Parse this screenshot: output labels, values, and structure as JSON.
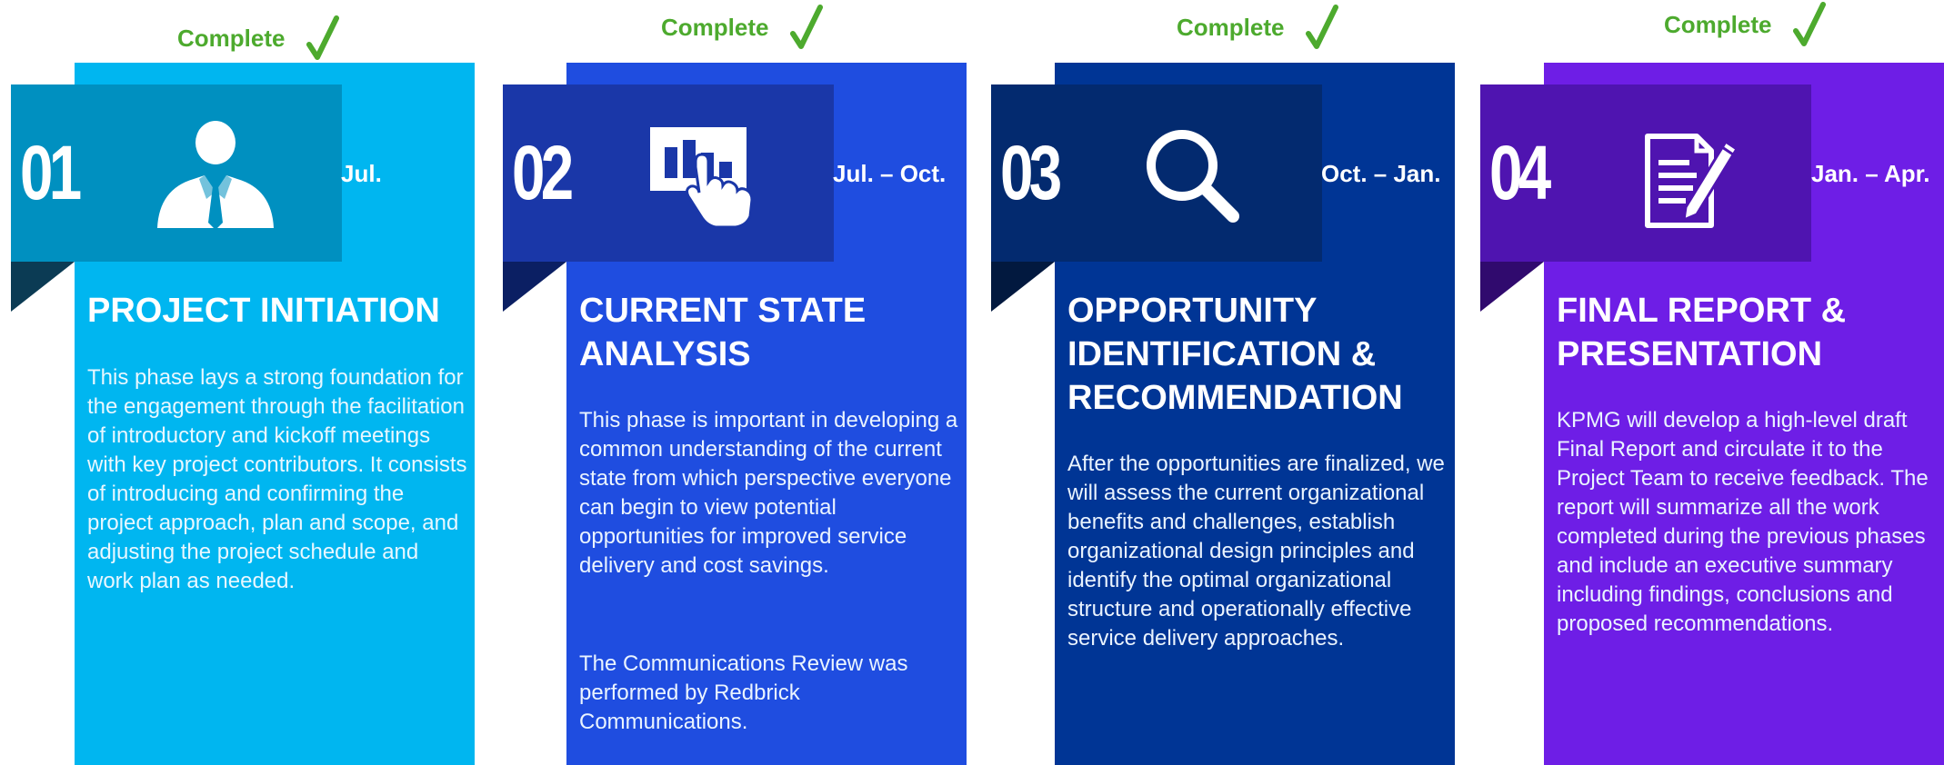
{
  "colors": {
    "status_green": "#4daa2e",
    "phase1_panel": "#00b6f0",
    "phase1_header": "#0090c0",
    "phase2_panel": "#1f4de0",
    "phase2_header": "#1a37a8",
    "phase3_panel": "#003595",
    "phase3_header": "#032a6f",
    "phase4_panel": "#6e1ee6",
    "phase4_header": "#4f14b0"
  },
  "phases": [
    {
      "status": "Complete",
      "status_icon": "checkmark-icon",
      "number": "01",
      "icon": "businessman-icon",
      "dates": "Jul.",
      "title": "PROJECT INITIATION",
      "description": "This phase lays a strong foundation for the engagement through the facilitation of introductory and kickoff meetings with key project contributors. It consists of introducing and confirming the project approach, plan and scope, and adjusting the project schedule and work plan as needed."
    },
    {
      "status": "Complete",
      "status_icon": "checkmark-icon",
      "number": "02",
      "icon": "chart-touch-icon",
      "dates": "Jul. – Oct.",
      "title": "CURRENT STATE ANALYSIS",
      "description": "This phase is important in developing a common understanding of the current state from which perspective everyone can begin to view potential opportunities for improved service delivery and cost savings.",
      "note": "The Communications Review was performed by Redbrick Communications."
    },
    {
      "status": "Complete",
      "status_icon": "checkmark-icon",
      "number": "03",
      "icon": "magnifier-icon",
      "dates": "Oct. – Jan.",
      "title": "OPPORTUNITY IDENTIFICATION & RECOMMENDATION",
      "description": "After the opportunities are finalized, we will assess the current organizational benefits and challenges, establish organizational design principles and identify the optimal organizational structure and operationally effective service delivery approaches."
    },
    {
      "status": "Complete",
      "status_icon": "checkmark-icon",
      "number": "04",
      "icon": "document-pen-icon",
      "dates": "Jan. – Apr.",
      "title": "FINAL REPORT & PRESENTATION",
      "description": "KPMG will develop a high-level draft Final Report and circulate it to the Project Team to receive feedback. The report will summarize all the work completed during the previous phases and include an executive summary including findings, conclusions and proposed recommendations."
    }
  ]
}
